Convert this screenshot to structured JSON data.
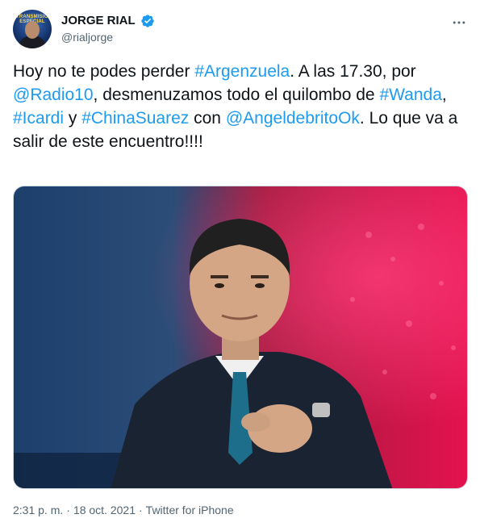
{
  "author": {
    "name": "JORGE RIAL",
    "handle": "@rialjorge",
    "verified_icon": "verified-badge-icon",
    "avatar_caption": "TRANSMISION ESPECIAL"
  },
  "tweet": {
    "segments": [
      {
        "text": "Hoy no te podes perder ",
        "type": "text"
      },
      {
        "text": "#Argenzuela",
        "type": "link"
      },
      {
        "text": ". A las 17.30, por ",
        "type": "text"
      },
      {
        "text": "@Radio10",
        "type": "link"
      },
      {
        "text": ",  desmenuzamos todo el quilombo de ",
        "type": "text"
      },
      {
        "text": "#Wanda",
        "type": "link"
      },
      {
        "text": ", ",
        "type": "text"
      },
      {
        "text": "#Icardi",
        "type": "link"
      },
      {
        "text": " y ",
        "type": "text"
      },
      {
        "text": "#ChinaSuarez",
        "type": "link"
      },
      {
        "text": " con ",
        "type": "text"
      },
      {
        "text": "@AngeldebritoOk",
        "type": "link"
      },
      {
        "text": ". Lo que va a salir de este encuentro!!!!",
        "type": "text"
      }
    ]
  },
  "meta": {
    "time": "2:31 p. m.",
    "separator1": "·",
    "date": "18 oct. 2021",
    "separator2": "·",
    "source": "Twitter for iPhone"
  },
  "colors": {
    "link": "#1d9bf0",
    "verified": "#1d9bf0",
    "secondary_text": "#536471"
  },
  "icons": {
    "more": "more-options-icon"
  }
}
